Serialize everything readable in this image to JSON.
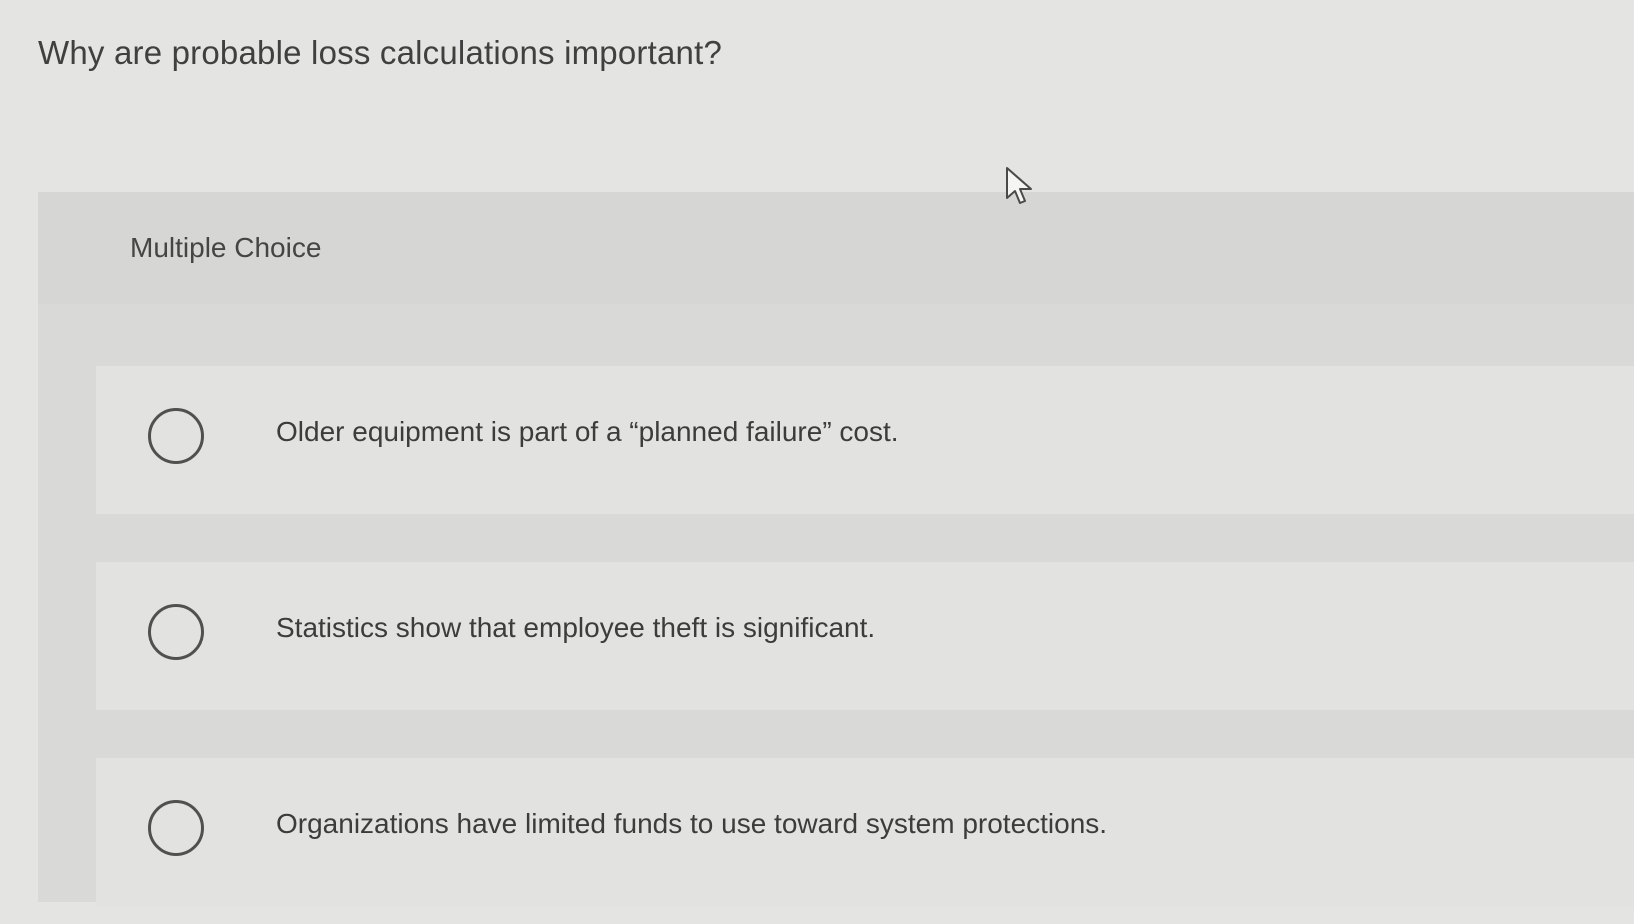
{
  "question": {
    "text": "Why are probable loss calculations important?"
  },
  "multiple_choice": {
    "label": "Multiple Choice",
    "options": [
      {
        "text": "Older equipment is part of a “planned failure” cost.",
        "selected": false
      },
      {
        "text": "Statistics show that employee theft is significant.",
        "selected": false
      },
      {
        "text": "Organizations have limited funds to use toward system protections.",
        "selected": false
      }
    ]
  },
  "pointer": {
    "icon": "mouse-pointer-icon"
  },
  "colors": {
    "background": "#e4e4e2",
    "panel": "#d9d9d7",
    "option_row": "#e2e2e0",
    "text": "#3f3f3f",
    "radio_border": "#505050"
  }
}
